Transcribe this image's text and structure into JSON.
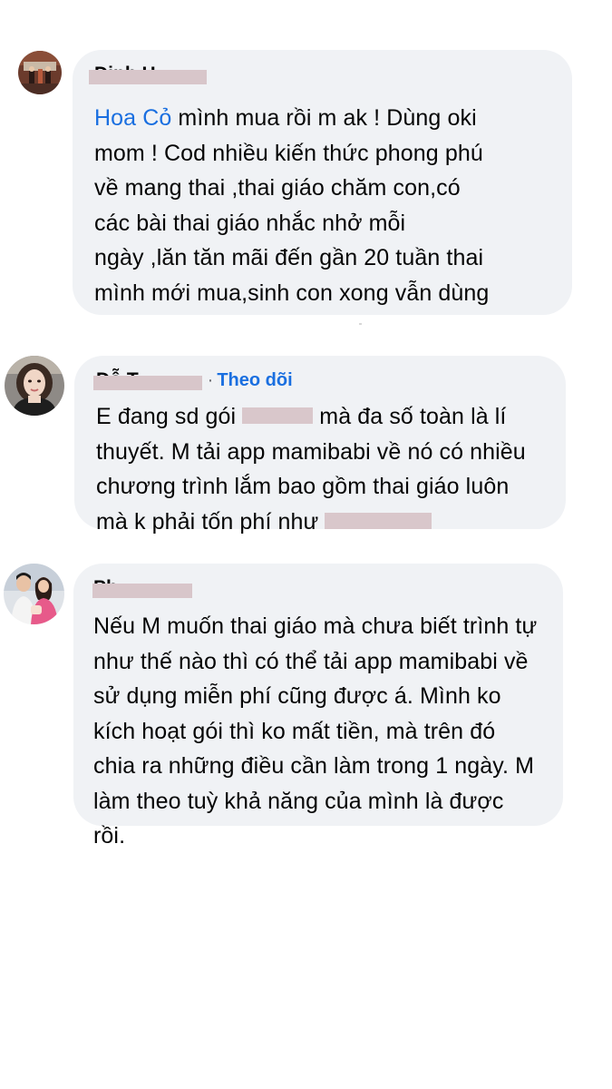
{
  "comments": [
    {
      "author": "Dinh H",
      "mention": "Hoa Cỏ",
      "lines": [
        "mình mua rồi m ak ! Dùng oki",
        "mom ! Cod nhiều kiến thức phong phú",
        "về mang thai ,thai giáo chăm con,có",
        "các bài thai giáo nhắc nhở mỗi",
        "ngày ,lăn tăn mãi đến gần 20 tuần thai",
        "mình mới mua,sinh con xong vẫn dùng"
      ]
    },
    {
      "author": "Đỗ T",
      "follow_label": "Theo dõi",
      "line1_before": "E đang sd gói ",
      "line1_after": " mà đa số toàn là lí",
      "lines": [
        "thuyết. M tải app mamibabi về nó có nhiều",
        "chương trình lắm bao gồm thai giáo luôn"
      ],
      "line4_before": "mà k phải tốn phí như "
    },
    {
      "author": "Ph",
      "lines": [
        "Nếu M muốn thai giáo mà chưa biết trình tự",
        "như thế nào thì có thể tải app mamibabi về",
        "sử dụng miễn phí cũng được á. Mình ko",
        "kích hoạt gói thì ko mất tiền, mà trên đó",
        "chia ra những điều cần làm trong 1 ngày. M",
        "làm theo tuỳ khả năng của mình là được",
        "rồi."
      ]
    }
  ],
  "colors": {
    "bubble": "#f0f2f5",
    "link": "#1a6fe0",
    "text": "#050505",
    "redaction": "#d8c6ca"
  }
}
